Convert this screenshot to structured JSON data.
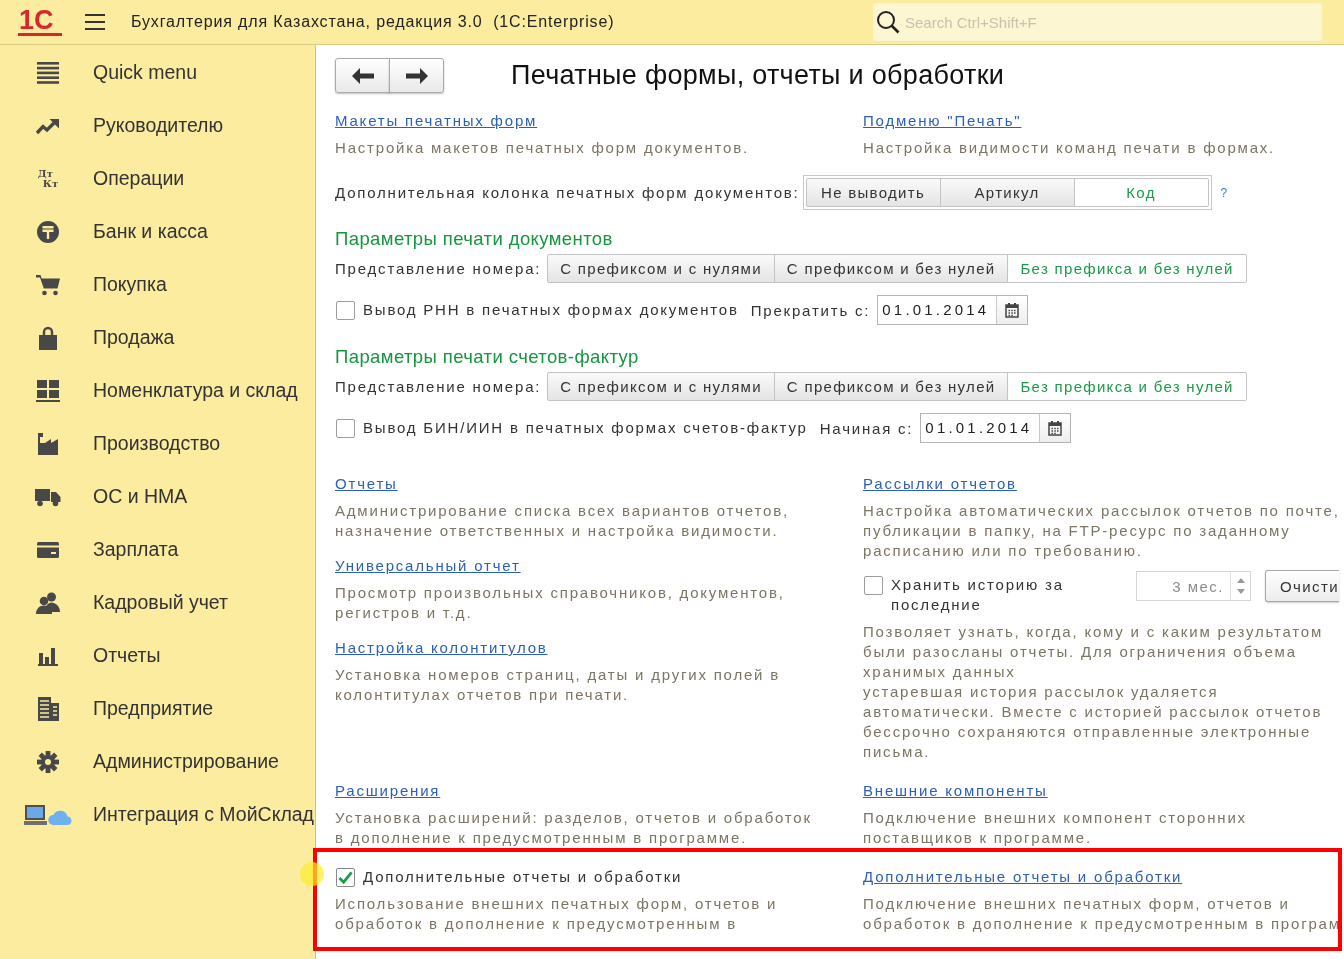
{
  "top_bar": {
    "logo": "1С",
    "title": "Бухгалтерия для Казахстана, редакция 3.0  (1C:Enterprise)",
    "search": {
      "placeholder": "Search Ctrl+Shift+F"
    }
  },
  "sidebar": {
    "items": [
      {
        "label": "Quick menu",
        "selected": false
      },
      {
        "label": "Руководителю",
        "selected": false
      },
      {
        "label": "Операции",
        "selected": false,
        "icon_text": [
          "Дт",
          "Кт"
        ]
      },
      {
        "label": "Банк и касса",
        "selected": false
      },
      {
        "label": "Покупка",
        "selected": false
      },
      {
        "label": "Продажа",
        "selected": false
      },
      {
        "label": "Номенклатура и склад",
        "selected": false
      },
      {
        "label": "Производство",
        "selected": false
      },
      {
        "label": "ОС и НМА",
        "selected": false
      },
      {
        "label": "Зарплата",
        "selected": false
      },
      {
        "label": "Кадровый учет",
        "selected": false
      },
      {
        "label": "Отчеты",
        "selected": false
      },
      {
        "label": "Предприятие",
        "selected": false
      },
      {
        "label": "Администрирование",
        "selected": false
      },
      {
        "label": "Интеграция с МойСклад",
        "selected": false
      }
    ]
  },
  "page": {
    "title": "Печатные формы, отчеты и обработки",
    "rows": [
      {
        "kind": "pair",
        "highlighted": false,
        "left": [
          {
            "kind": "link",
            "link": "Макеты печатных форм",
            "description": "Настройка макетов печатных форм документов."
          }
        ],
        "right": [
          {
            "kind": "link",
            "link": "Подменю \"Печать\"",
            "description": "Настройка видимости команд печати в формах."
          }
        ]
      },
      {
        "kind": "choice",
        "label": "Дополнительная колонка печатных форм документов:",
        "focused": true,
        "options": [
          {
            "label": "Не выводить",
            "selected": false
          },
          {
            "label": "Артикул",
            "selected": false
          },
          {
            "label": "Код",
            "selected": true
          }
        ],
        "help": "?"
      },
      {
        "kind": "heading",
        "text": "Параметры печати документов"
      },
      {
        "kind": "choice",
        "label": "Представление номера:",
        "focused": false,
        "options": [
          {
            "label": "С префиксом и с нулями",
            "selected": false
          },
          {
            "label": "С префиксом и без нулей",
            "selected": false
          },
          {
            "label": "Без префикса и без нулей",
            "selected": true
          }
        ]
      },
      {
        "kind": "checkbox-date",
        "label": "Вывод РНН в печатных формах документов",
        "checked": false,
        "date_label": "Прекратить с:",
        "date": "01.01.2014"
      },
      {
        "kind": "heading",
        "text": "Параметры печати счетов-фактур"
      },
      {
        "kind": "choice",
        "label": "Представление номера:",
        "focused": false,
        "options": [
          {
            "label": "С префиксом и с нулями",
            "selected": false
          },
          {
            "label": "С префиксом и без нулей",
            "selected": false
          },
          {
            "label": "Без префикса и без нулей",
            "selected": true
          }
        ]
      },
      {
        "kind": "checkbox-date",
        "label": "Вывод БИН/ИИН в печатных формах счетов-фактур",
        "checked": false,
        "date_label": "Начиная с:",
        "date": "01.01.2014"
      },
      {
        "kind": "pair",
        "highlighted": false,
        "left": [
          {
            "kind": "link",
            "link": "Отчеты",
            "description": "Администрирование списка всех вариантов отчетов, назначение ответственных и настройка видимости."
          },
          {
            "kind": "link",
            "link": "Универсальный отчет",
            "description": "Просмотр произвольных справочников, документов, регистров и т.д."
          },
          {
            "kind": "link",
            "link": "Настройка колонтитулов",
            "description": "Установка номеров страниц, даты и других полей в колонтитулах отчетов при печати."
          }
        ],
        "right": [
          {
            "kind": "link",
            "link": "Рассылки отчетов",
            "description": "Настройка автоматических рассылок отчетов по почте, публикации в папку, на FTP-ресурс по заданному расписанию или по требованию."
          },
          {
            "kind": "retention",
            "label": "Хранить историю за последние",
            "checked": false,
            "spinner": {
              "value": "3 мес.",
              "disabled": true
            },
            "button": "Очисти",
            "description": "Позволяет узнать, когда, кому и с каким результатом были разосланы отчеты. Для ограничения объема хранимых данных\nустаревшая история рассылок удаляется автоматически. Вместе с историей рассылок отчетов бессрочно сохраняются отправленные электронные письма."
          }
        ]
      },
      {
        "kind": "pair",
        "highlighted": false,
        "left": [
          {
            "kind": "link",
            "link": "Расширения",
            "description": "Установка расширений: разделов, отчетов и обработок в дополнение к предусмотренным в программе."
          }
        ],
        "right": [
          {
            "kind": "link",
            "link": "Внешние компоненты",
            "description": "Подключение внешних компонент сторонних поставщиков к программе."
          }
        ]
      },
      {
        "kind": "pair",
        "highlighted": true,
        "left": [
          {
            "kind": "checkbox",
            "label": "Дополнительные отчеты и обработки",
            "checked": true,
            "description": "Использование внешних печатных форм, отчетов и обработок в дополнение к предусмотренным в"
          }
        ],
        "right": [
          {
            "kind": "link",
            "link": "Дополнительные отчеты и обработки",
            "description": "Подключение внешних печатных форм, отчетов и обработок в дополнение к предусмотренным в програм"
          }
        ]
      }
    ]
  }
}
